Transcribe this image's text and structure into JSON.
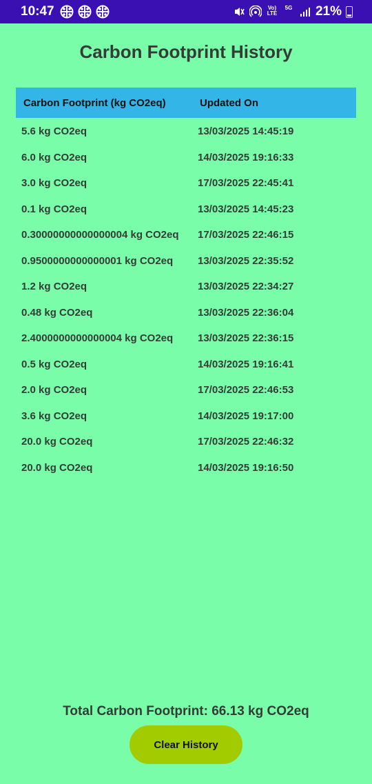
{
  "status_bar": {
    "time": "10:47",
    "battery": "21%",
    "net_volte": "Vo)\nLTE",
    "net_5g": "5G"
  },
  "title": "Carbon Footprint History",
  "table": {
    "headers": [
      "Carbon Footprint (kg CO2eq)",
      "Updated On"
    ],
    "rows": [
      [
        "5.6 kg CO2eq",
        "13/03/2025 14:45:19"
      ],
      [
        "6.0 kg CO2eq",
        "14/03/2025 19:16:33"
      ],
      [
        "3.0 kg CO2eq",
        "17/03/2025 22:45:41"
      ],
      [
        "0.1 kg CO2eq",
        "13/03/2025 14:45:23"
      ],
      [
        "0.30000000000000004 kg CO2eq",
        "17/03/2025 22:46:15"
      ],
      [
        "0.9500000000000001 kg CO2eq",
        "13/03/2025 22:35:52"
      ],
      [
        "1.2 kg CO2eq",
        "13/03/2025 22:34:27"
      ],
      [
        "0.48 kg CO2eq",
        "13/03/2025 22:36:04"
      ],
      [
        "2.4000000000000004 kg CO2eq",
        "13/03/2025 22:36:15"
      ],
      [
        "0.5 kg CO2eq",
        "14/03/2025 19:16:41"
      ],
      [
        "2.0 kg CO2eq",
        "17/03/2025 22:46:53"
      ],
      [
        "3.6 kg CO2eq",
        "14/03/2025 19:17:00"
      ],
      [
        "20.0 kg CO2eq",
        "17/03/2025 22:46:32"
      ],
      [
        "20.0 kg CO2eq",
        "14/03/2025 19:16:50"
      ]
    ]
  },
  "total": "Total Carbon Footprint: 66.13 kg CO2eq",
  "clear_button": "Clear History",
  "colors": {
    "background": "#79fda8",
    "status_bar": "#3a10b3",
    "header": "#34b5e8",
    "button": "#a2cc00",
    "text": "#333c37"
  }
}
